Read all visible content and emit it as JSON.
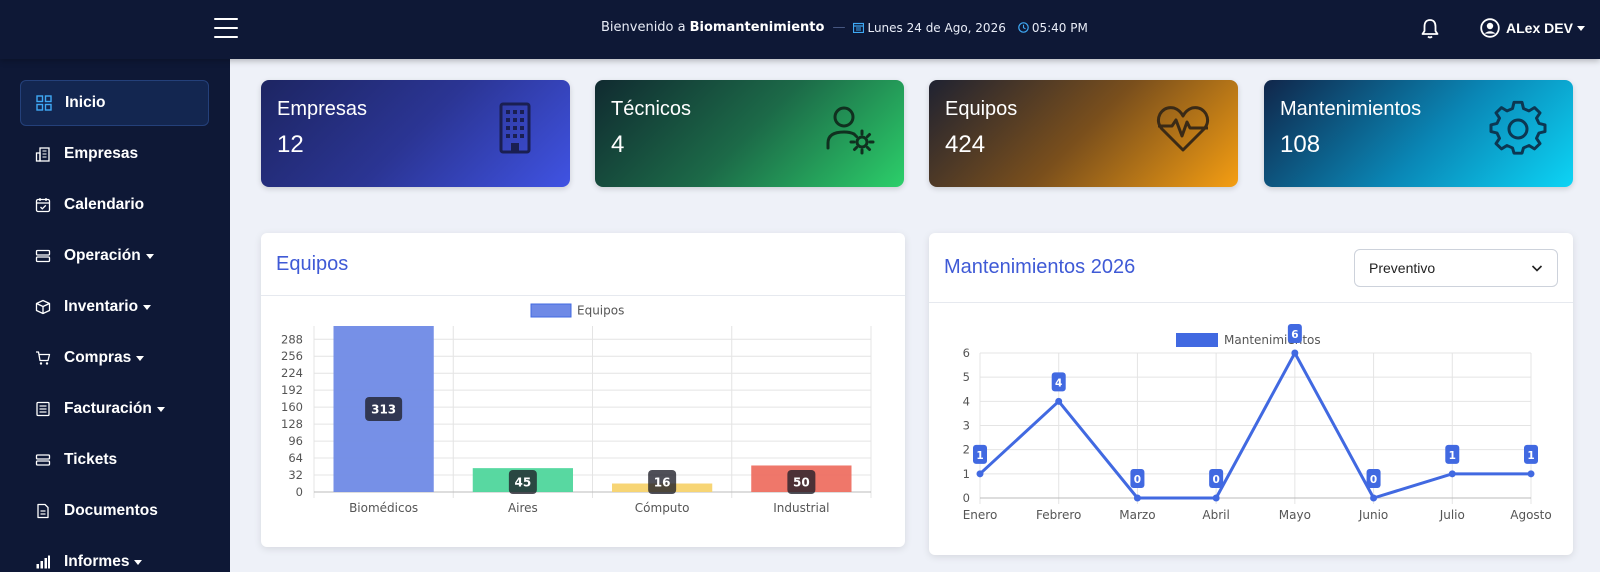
{
  "topbar": {
    "welcome_prefix": "Bienvenido a",
    "app_name": "Biomantenimiento",
    "date": "Lunes 24 de Ago, 2026",
    "time": "05:40 PM",
    "user_name": "ALex DEV"
  },
  "sidebar": {
    "items": [
      {
        "label": "Inicio",
        "icon": "grid-icon",
        "active": true
      },
      {
        "label": "Empresas",
        "icon": "building-icon"
      },
      {
        "label": "Calendario",
        "icon": "calendar-icon"
      },
      {
        "label": "Operación",
        "icon": "server-icon",
        "dropdown": true
      },
      {
        "label": "Inventario",
        "icon": "box-icon",
        "dropdown": true
      },
      {
        "label": "Compras",
        "icon": "cart-icon",
        "dropdown": true
      },
      {
        "label": "Facturación",
        "icon": "invoice-icon",
        "dropdown": true
      },
      {
        "label": "Tickets",
        "icon": "ticket-icon"
      },
      {
        "label": "Documentos",
        "icon": "document-icon"
      },
      {
        "label": "Informes",
        "icon": "chart-icon",
        "dropdown": true
      }
    ]
  },
  "cards": [
    {
      "title": "Empresas",
      "value": "12",
      "icon": "building-icon"
    },
    {
      "title": "Técnicos",
      "value": "4",
      "icon": "user-gear-icon"
    },
    {
      "title": "Equipos",
      "value": "424",
      "icon": "heart-pulse-icon"
    },
    {
      "title": "Mantenimientos",
      "value": "108",
      "icon": "gear-icon"
    }
  ],
  "panels": {
    "equipos_title": "Equipos",
    "mant_title": "Mantenimientos 2026",
    "mant_filter": "Preventivo"
  },
  "chart_data": [
    {
      "type": "bar",
      "legend": "Equipos",
      "legend_position": "top",
      "categories": [
        "Biomédicos",
        "Aires",
        "Cómputo",
        "Industrial"
      ],
      "values": [
        313,
        45,
        16,
        50
      ],
      "colors": [
        "#6f8ae6",
        "#4fd69c",
        "#f7d36e",
        "#ee7062"
      ],
      "yticks": [
        "0",
        "32",
        "64",
        "96",
        "128",
        "160",
        "192",
        "224",
        "256",
        "288"
      ],
      "ylim": [
        0,
        313
      ],
      "grid": true
    },
    {
      "type": "line",
      "legend": "Mantenimientos",
      "legend_position": "top",
      "categories": [
        "Enero",
        "Febrero",
        "Marzo",
        "Abril",
        "Mayo",
        "Junio",
        "Julio",
        "Agosto"
      ],
      "values": [
        1,
        4,
        0,
        0,
        6,
        0,
        1,
        1
      ],
      "color": "#4169e1",
      "yticks": [
        "0",
        "1",
        "2",
        "3",
        "4",
        "5",
        "6"
      ],
      "ylim": [
        0,
        6
      ],
      "grid": true
    }
  ]
}
